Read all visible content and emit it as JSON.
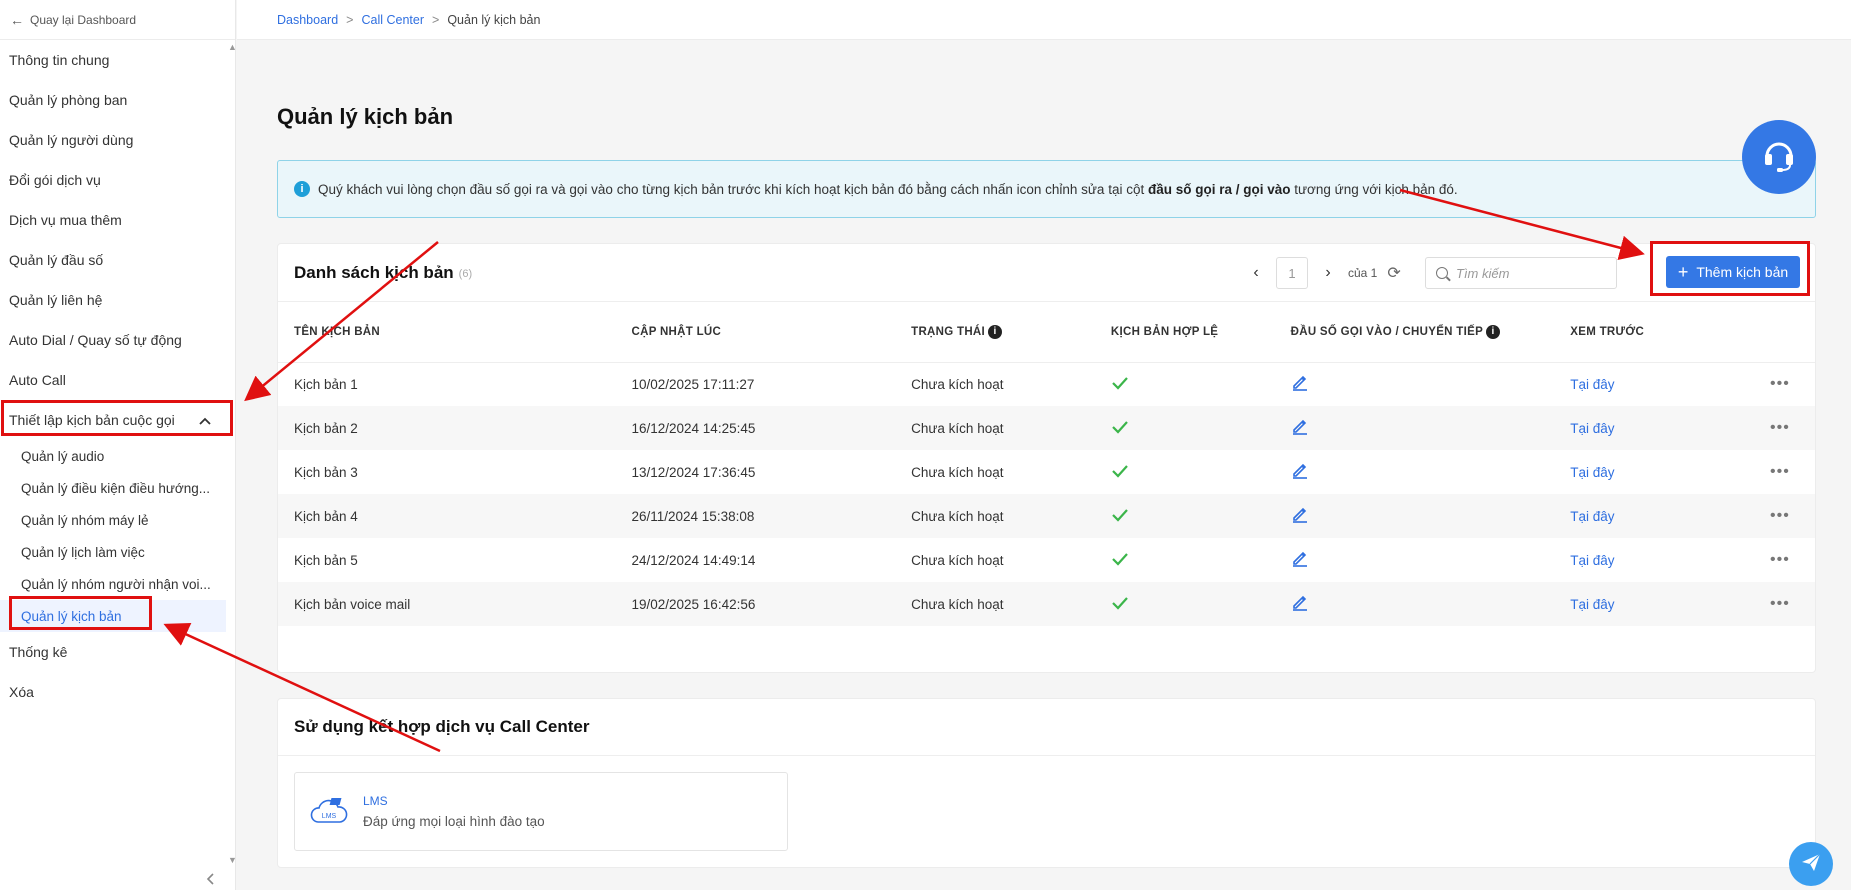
{
  "sidebar": {
    "back_label": "Quay lại Dashboard",
    "items": [
      {
        "label": "Thông tin chung"
      },
      {
        "label": "Quản lý phòng ban"
      },
      {
        "label": "Quản lý người dùng"
      },
      {
        "label": "Đổi gói dịch vụ"
      },
      {
        "label": "Dịch vụ mua thêm"
      },
      {
        "label": "Quản lý đầu số"
      },
      {
        "label": "Quản lý liên hệ"
      },
      {
        "label": "Auto Dial / Quay số tự động"
      },
      {
        "label": "Auto Call"
      },
      {
        "label": "Thiết lập kịch bản cuộc gọi"
      }
    ],
    "sub_items": [
      {
        "label": "Quản lý audio"
      },
      {
        "label": "Quản lý điều kiện điều hướng..."
      },
      {
        "label": "Quản lý nhóm máy lẻ"
      },
      {
        "label": "Quản lý lịch làm việc"
      },
      {
        "label": "Quản lý nhóm người nhận voi..."
      },
      {
        "label": "Quản lý kịch bản"
      }
    ],
    "after_items": [
      {
        "label": "Thống kê"
      },
      {
        "label": "Xóa"
      }
    ]
  },
  "breadcrumb": {
    "items": [
      "Dashboard",
      "Call Center",
      "Quản lý kịch bản"
    ],
    "sep": ">"
  },
  "page": {
    "title": "Quản lý kịch bản",
    "notice_prefix": "Quý khách vui lòng chọn đầu số gọi ra và gọi vào cho từng kịch bản trước khi kích hoạt kịch bản đó bằng cách nhấn icon chỉnh sửa tại cột ",
    "notice_bold": "đầu số gọi ra / gọi vào",
    "notice_suffix": " tương ứng với kịch bản đó."
  },
  "list": {
    "title": "Danh sách kịch bản",
    "count": "(6)",
    "page_value": "1",
    "page_of": "của 1",
    "search_placeholder": "Tìm kiếm",
    "add_label": "Thêm kịch bản",
    "columns": [
      "TÊN KỊCH BẢN",
      "CẬP NHẬT LÚC",
      "TRẠNG THÁI",
      "KỊCH BẢN HỢP LỆ",
      "ĐẦU SỐ GỌI VÀO / CHUYỂN TIẾP",
      "XEM TRƯỚC"
    ],
    "rows": [
      {
        "name": "Kịch bản 1",
        "updated": "10/02/2025 17:11:27",
        "status": "Chưa kích hoạt",
        "preview": "Tại đây"
      },
      {
        "name": "Kịch bản 2",
        "updated": "16/12/2024 14:25:45",
        "status": "Chưa kích hoạt",
        "preview": "Tại đây"
      },
      {
        "name": "Kịch bản 3",
        "updated": "13/12/2024 17:36:45",
        "status": "Chưa kích hoạt",
        "preview": "Tại đây"
      },
      {
        "name": "Kịch bản 4",
        "updated": "26/11/2024 15:38:08",
        "status": "Chưa kích hoạt",
        "preview": "Tại đây"
      },
      {
        "name": "Kịch bản 5",
        "updated": "24/12/2024 14:49:14",
        "status": "Chưa kích hoạt",
        "preview": "Tại đây"
      },
      {
        "name": "Kịch bản voice mail",
        "updated": "19/02/2025 16:42:56",
        "status": "Chưa kích hoạt",
        "preview": "Tại đây"
      }
    ]
  },
  "combo": {
    "title": "Sử dụng kết hợp dịch vụ Call Center",
    "service_name": "LMS",
    "service_desc": "Đáp ứng mọi loại hình đào tạo",
    "icon_text": "LMS"
  },
  "colors": {
    "accent": "#3478e5",
    "annotation": "#e01010",
    "check": "#3bb54a"
  }
}
